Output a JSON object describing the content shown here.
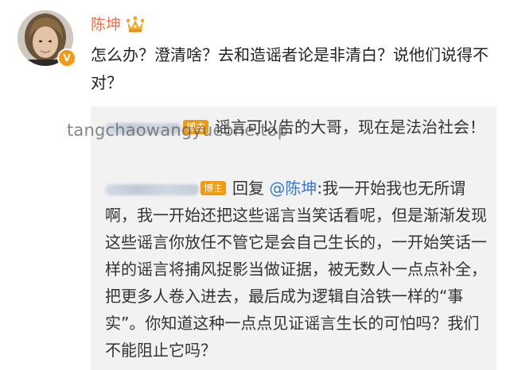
{
  "post": {
    "author": "陈坤",
    "verified_mark": "V",
    "text": "怎么办？澄清啥？去和造谣者论是非清白？说他们说得不对？"
  },
  "comments": [
    {
      "badge": "博主",
      "text": "谣言可以告的大哥，现在是法治社会！"
    },
    {
      "badge": "博主",
      "reply_prefix": "回复",
      "mention": "@陈坤",
      "text": ":我一开始我也无所谓啊，我一开始还把这些谣言当笑话看呢，但是渐渐发现这些谣言你放任不管它是会自己生长的，一开始笑话一样的谣言将捕风捉影当做证据，被无数人一点点补全，把更多人卷入进去，最后成为逻辑自洽铁一样的“事实”。你知道这种一点点见证谣言生长的可怕吗？我们不能阻止它吗？"
    }
  ],
  "watermark": "tangchaowangyueone.top",
  "colors": {
    "author_name": "#eb7350",
    "badge": "#f29a10",
    "mention": "#3a7ac8",
    "comment_bg": "#f2f2f2"
  }
}
